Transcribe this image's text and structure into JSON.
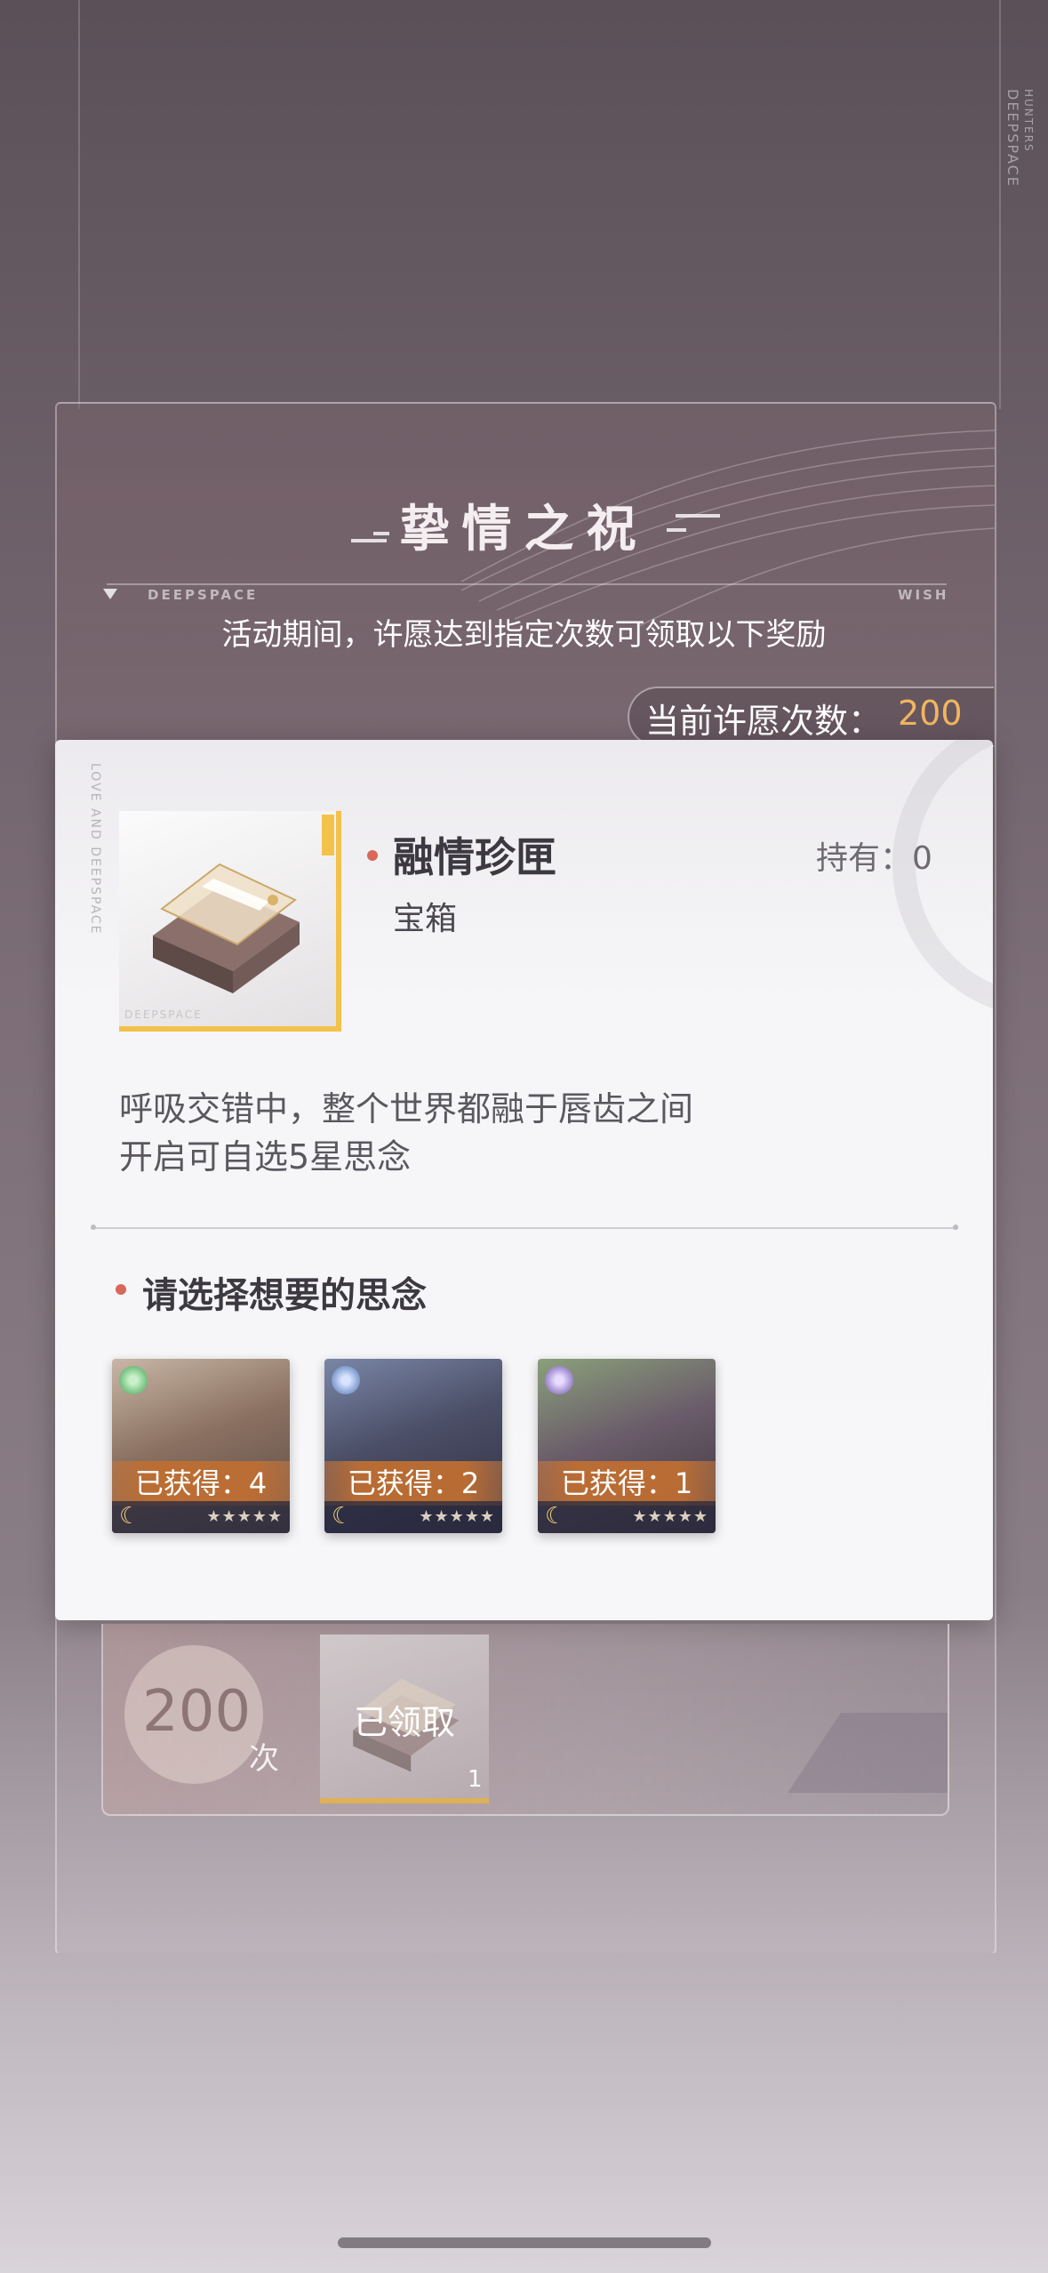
{
  "header": {
    "title": "挚情之祝",
    "label_left": "DEEPSPACE",
    "label_right": "WISH",
    "subtitle": "活动期间，许愿达到指定次数可领取以下奖励",
    "wish_count_label": "当前许愿次数：",
    "wish_count_value": "200",
    "corner_brand_1": "DEEPSPACE",
    "corner_brand_2": "HUNTERS"
  },
  "card": {
    "side_text": "LOVE AND DEEPSPACE",
    "item_name": "融情珍匣",
    "item_type": "宝箱",
    "holding": "持有：0",
    "thumb_brand": "DEEPSPACE",
    "description_line1": "呼吸交错中，整个世界都融于唇齿之间",
    "description_line2": "开启可自选5星思念",
    "choose_title": "请选择想要的思念",
    "options": [
      {
        "obtained": "已获得：4",
        "stars": "★★★★★",
        "orb_color": "#7fc98a"
      },
      {
        "obtained": "已获得：2",
        "stars": "★★★★★",
        "orb_color": "#8fa8d8"
      },
      {
        "obtained": "已获得：1",
        "stars": "★★★★★",
        "orb_color": "#a894d4"
      }
    ]
  },
  "reward": {
    "count": "200",
    "unit": "次",
    "status": "已领取",
    "quantity": "1"
  },
  "colors": {
    "accent_gold": "#f2b560",
    "bullet_red": "#d8685a",
    "frame_gold": "#f3c24b"
  }
}
